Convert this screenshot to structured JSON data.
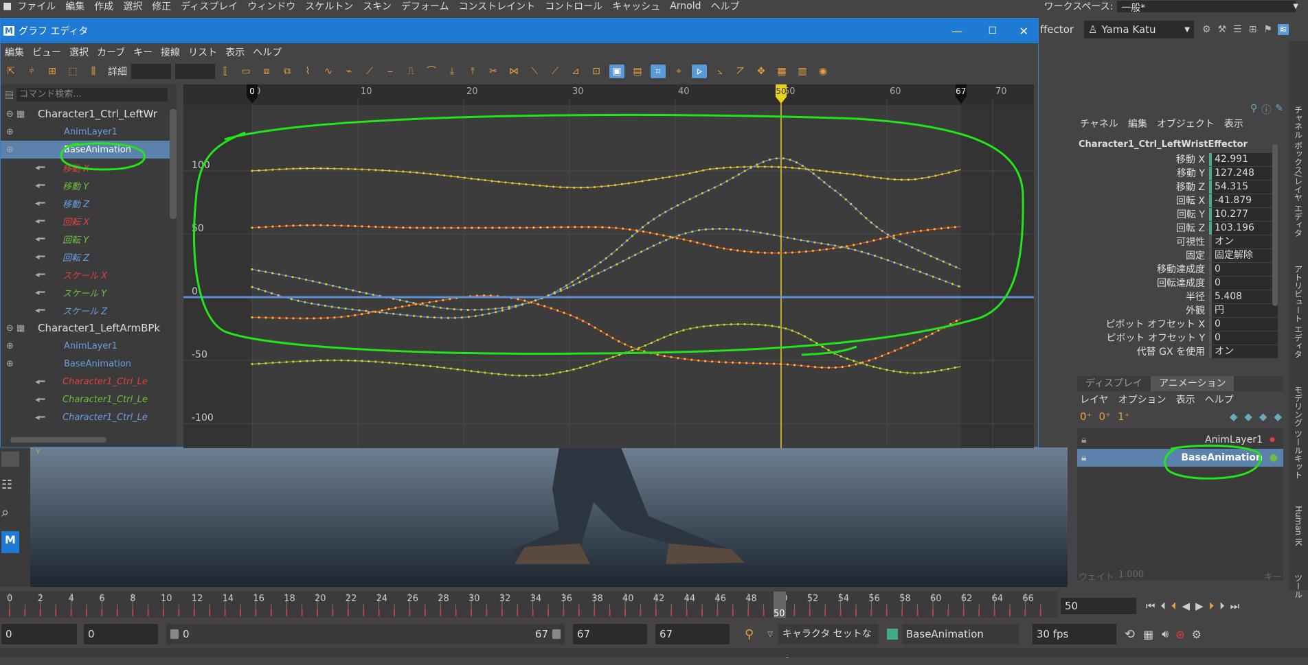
{
  "menubar": {
    "items": [
      "ファイル",
      "編集",
      "作成",
      "選択",
      "修正",
      "ディスプレイ",
      "ウィンドウ",
      "スケルトン",
      "スキン",
      "デフォーム",
      "コンストレイント",
      "コントロール",
      "キャッシュ",
      "Arnold",
      "ヘルプ"
    ],
    "workspace_label": "ワークスペース:",
    "workspace_value": "一般*"
  },
  "status": {
    "effector_label": "ffector",
    "user": "Yama Katu"
  },
  "graph_editor": {
    "title": "グラフ エディタ",
    "menu": [
      "編集",
      "ビュー",
      "選択",
      "カーブ",
      "キー",
      "接線",
      "リスト",
      "表示",
      "ヘルプ"
    ],
    "detail_label": "詳細",
    "search_placeholder": "コマンド検索...",
    "outliner": [
      {
        "label": "Character1_Ctrl_LeftWr",
        "color": "#dddddd",
        "indent": 0,
        "node": true
      },
      {
        "label": "AnimLayer1",
        "color": "#6a9ee0",
        "indent": 1
      },
      {
        "label": "BaseAnimation",
        "color": "#ffffff",
        "indent": 1,
        "selected": true
      },
      {
        "label": "移動 X",
        "color": "#e04040",
        "indent": 2,
        "curve": true
      },
      {
        "label": "移動 Y",
        "color": "#6cc040",
        "indent": 2,
        "curve": true
      },
      {
        "label": "移動 Z",
        "color": "#6a9ee0",
        "indent": 2,
        "curve": true
      },
      {
        "label": "回転 X",
        "color": "#e04040",
        "indent": 2,
        "curve": true
      },
      {
        "label": "回転 Y",
        "color": "#6cc040",
        "indent": 2,
        "curve": true
      },
      {
        "label": "回転 Z",
        "color": "#6a9ee0",
        "indent": 2,
        "curve": true
      },
      {
        "label": "スケール X",
        "color": "#e04040",
        "indent": 2,
        "curve": true
      },
      {
        "label": "スケール Y",
        "color": "#6cc040",
        "indent": 2,
        "curve": true
      },
      {
        "label": "スケール Z",
        "color": "#6a9ee0",
        "indent": 2,
        "curve": true
      },
      {
        "label": "Character1_LeftArmBPk",
        "color": "#dddddd",
        "indent": 0,
        "node": true
      },
      {
        "label": "AnimLayer1",
        "color": "#6a9ee0",
        "indent": 1
      },
      {
        "label": "BaseAnimation",
        "color": "#6a9ee0",
        "indent": 1
      },
      {
        "label": "Character1_Ctrl_Le",
        "color": "#e04040",
        "indent": 2,
        "curve": true
      },
      {
        "label": "Character1_Ctrl_Le",
        "color": "#6cc040",
        "indent": 2,
        "curve": true
      },
      {
        "label": "Character1_Ctrl_Le",
        "color": "#6a9ee0",
        "indent": 2,
        "curve": true
      }
    ],
    "ruler": {
      "ticks": [
        "0",
        "10",
        "20",
        "30",
        "40",
        "50",
        "60",
        "70"
      ],
      "start_marker": "0",
      "current": "50",
      "end_marker": "67"
    },
    "yticks": [
      "100",
      "50",
      "0",
      "-50",
      "-100"
    ]
  },
  "channel_box": {
    "tabs": [
      "チャネル",
      "編集",
      "オブジェクト",
      "表示"
    ],
    "object": "Character1_Ctrl_LeftWristEffector",
    "attributes": [
      {
        "label": "移動 X",
        "value": "42.991"
      },
      {
        "label": "移動 Y",
        "value": "127.248"
      },
      {
        "label": "移動 Z",
        "value": "54.315"
      },
      {
        "label": "回転 X",
        "value": "-41.879"
      },
      {
        "label": "回転 Y",
        "value": "10.277"
      },
      {
        "label": "回転 Z",
        "value": "103.196"
      },
      {
        "label": "可視性",
        "value": "オン"
      },
      {
        "label": "固定",
        "value": "固定解除"
      },
      {
        "label": "移動達成度",
        "value": "0"
      },
      {
        "label": "回転達成度",
        "value": "0"
      },
      {
        "label": "半径",
        "value": "5.408"
      },
      {
        "label": "外観",
        "value": "円"
      },
      {
        "label": "ピボット オフセット X",
        "value": "0"
      },
      {
        "label": "ピボット オフセット Y",
        "value": "0"
      },
      {
        "label": "代替 GX を使用",
        "value": "オン"
      }
    ],
    "side_tabs": [
      "チャネル ボックス/レイヤ エディタ",
      "アトリビュート エディタ",
      "モデリング ツールキット",
      "Human IK",
      "ツール"
    ]
  },
  "layer_editor": {
    "tabs": [
      "ディスプレイ",
      "アニメーション"
    ],
    "menu": [
      "レイヤ",
      "オプション",
      "表示",
      "ヘルプ"
    ],
    "layers": [
      "AnimLayer1",
      "BaseAnimation"
    ],
    "weight_label": "ウェイト",
    "weight_value": "1.000",
    "key_label": "キー"
  },
  "timeline": {
    "ticks": [
      "0",
      "2",
      "4",
      "6",
      "8",
      "10",
      "12",
      "14",
      "16",
      "18",
      "20",
      "22",
      "24",
      "26",
      "28",
      "30",
      "32",
      "34",
      "36",
      "38",
      "40",
      "42",
      "44",
      "46",
      "48",
      "50",
      "52",
      "54",
      "56",
      "58",
      "60",
      "62",
      "64",
      "66"
    ],
    "current": "50",
    "current_field": "50"
  },
  "bottom": {
    "start": "0",
    "range_start": "0",
    "slider_start": "0",
    "slider_end": "67",
    "range_end": "67",
    "end": "67",
    "character_set": "キャラクタ セットなし",
    "anim_layer": "BaseAnimation",
    "fps": "30 fps"
  },
  "colors": {
    "accent": "#1e7ad2",
    "annotation": "#22e61a",
    "curve_red": "#e8452a",
    "curve_green": "#7fbf3a",
    "curve_blue": "#5b8fd6",
    "curve_yellow": "#c8b43a",
    "playhead": "#e8d21e"
  }
}
